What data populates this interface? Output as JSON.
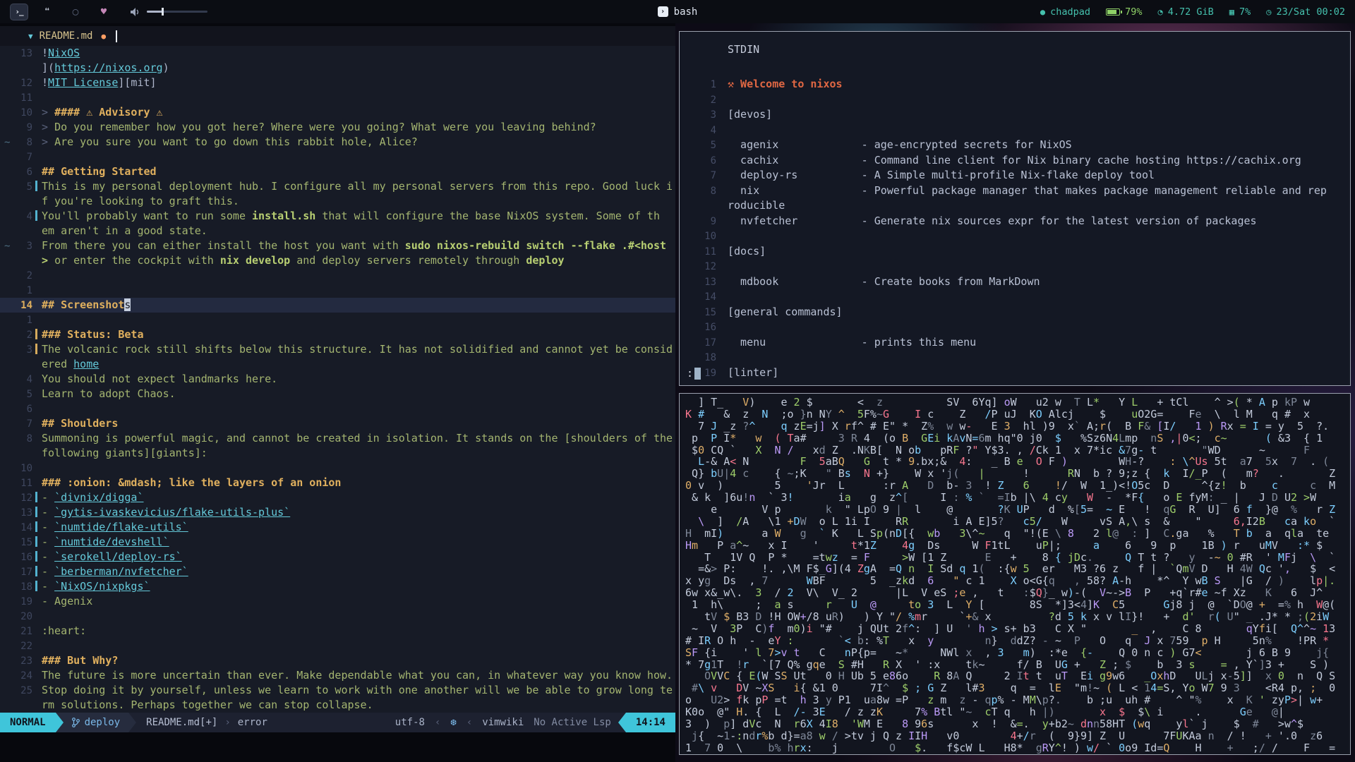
{
  "theme": {
    "bg_bar": "#0b0d13",
    "bg_editor": "#171b26",
    "bg_tabbar": "#12141d",
    "bg_status": "#1d2130",
    "bg_window": "#141824",
    "bg_noise": "#12151f",
    "accent": "#3fc5da",
    "teal": "#45c0ad",
    "green": "#8fd167",
    "yellow": "#e0b05e",
    "orange": "#ff9e64",
    "redorange": "#e06743",
    "md_text": "#a4b570",
    "code": "#b8cf72",
    "link": "#64c9d9"
  },
  "topbar": {
    "workspaces": [
      {
        "name": "terminal",
        "glyph": "›_",
        "active": true
      },
      {
        "name": "chat",
        "glyph": "❝",
        "active": false
      },
      {
        "name": "circle",
        "glyph": "◯",
        "active": false
      },
      {
        "name": "heart",
        "glyph": "♥",
        "active": false
      }
    ],
    "volume_percent": 25,
    "center": {
      "icon_glyph": "›",
      "label": "bash"
    },
    "status": {
      "host": "chadpad",
      "battery": "79%",
      "memory": "4.72 GiB",
      "cpu": "7%",
      "date": "23/Sat 00:02",
      "memory_icon": "◔",
      "cpu_icon": "▦",
      "date_icon": "◷",
      "host_icon": "●"
    }
  },
  "editor": {
    "tab": {
      "arrow": "▼",
      "filename": "README.md",
      "modified_dot": "●"
    },
    "rows": [
      {
        "n": "13",
        "t": [
          [
            "!",
            "w"
          ],
          [
            "NixOS",
            "l"
          ]
        ]
      },
      {
        "n": "",
        "t": [
          [
            "](",
            "w"
          ],
          [
            "https://nixos.org",
            "l"
          ],
          [
            ")",
            "w"
          ]
        ]
      },
      {
        "n": "12",
        "t": [
          [
            "!",
            "w"
          ],
          [
            "MIT License",
            "l"
          ],
          [
            "][mit]",
            "w"
          ]
        ]
      },
      {
        "n": "11",
        "t": []
      },
      {
        "n": "10",
        "t": [
          [
            "> ",
            "q"
          ],
          [
            "#### ⚠ Advisory ⚠",
            "h"
          ]
        ]
      },
      {
        "n": "9",
        "t": [
          [
            "> ",
            "q"
          ],
          [
            "Do you remember how you got here? Where were you going? What were you leaving behind?",
            "f"
          ]
        ]
      },
      {
        "n": "8",
        "p": "~",
        "t": [
          [
            "> ",
            "q"
          ],
          [
            "Are you sure you want to go down this rabbit hole, Alice?",
            "f"
          ]
        ]
      },
      {
        "n": "7",
        "t": []
      },
      {
        "n": "6",
        "t": [
          [
            "## Getting Started",
            "h"
          ]
        ]
      },
      {
        "n": "5",
        "s": "c",
        "t": [
          [
            "This is my personal deployment hub. I configure all my personal servers from this repo. Good luck i",
            "f"
          ]
        ]
      },
      {
        "n": "",
        "t": [
          [
            "f you're looking to graft this.",
            "f"
          ]
        ]
      },
      {
        "n": "4",
        "s": "c",
        "t": [
          [
            "You'll probably want to run some ",
            "f"
          ],
          [
            "install.sh",
            "c"
          ],
          [
            " that will configure the base NixOS system. Some of th",
            "f"
          ]
        ]
      },
      {
        "n": "",
        "t": [
          [
            "em aren't in a good state.",
            "f"
          ]
        ]
      },
      {
        "n": "3",
        "p": "~",
        "t": [
          [
            "From there you can either install the host you want with ",
            "f"
          ],
          [
            "sudo nixos-rebuild switch --flake .#<host",
            "c"
          ]
        ]
      },
      {
        "n": "",
        "t": [
          [
            "> ",
            "c"
          ],
          [
            "or enter the cockpit with ",
            "f"
          ],
          [
            "nix develop",
            "c"
          ],
          [
            " and deploy servers remotely through ",
            "f"
          ],
          [
            "deploy",
            "c"
          ]
        ]
      },
      {
        "n": "2",
        "t": []
      },
      {
        "n": "1",
        "t": []
      },
      {
        "n": "14",
        "cur": true,
        "t": [
          [
            "## Screenshot",
            "h"
          ],
          [
            "s",
            "k"
          ]
        ]
      },
      {
        "n": "1",
        "t": []
      },
      {
        "n": "2",
        "s": "y",
        "t": [
          [
            "### Status: Beta",
            "h"
          ]
        ]
      },
      {
        "n": "3",
        "s": "y",
        "t": [
          [
            "The volcanic rock still shifts below this structure. It has not solidified and cannot yet be consid",
            "f"
          ]
        ]
      },
      {
        "n": "",
        "t": [
          [
            "ered ",
            "f"
          ],
          [
            "home",
            "l"
          ]
        ]
      },
      {
        "n": "4",
        "t": [
          [
            "You should not expect landmarks here.",
            "f"
          ]
        ]
      },
      {
        "n": "5",
        "t": [
          [
            "Learn to adopt Chaos.",
            "f"
          ]
        ]
      },
      {
        "n": "6",
        "t": []
      },
      {
        "n": "7",
        "t": [
          [
            "## Shoulders",
            "h"
          ]
        ]
      },
      {
        "n": "8",
        "t": [
          [
            "Summoning is powerful magic, and cannot be created in isolation. It stands on the [shoulders of the",
            "f"
          ]
        ]
      },
      {
        "n": "",
        "t": [
          [
            "following giants][giants]:",
            "f"
          ]
        ]
      },
      {
        "n": "10",
        "t": []
      },
      {
        "n": "11",
        "t": [
          [
            "### :onion: &mdash; like the layers of an onion",
            "h"
          ]
        ]
      },
      {
        "n": "12",
        "s": "c",
        "t": [
          [
            "- ",
            "f"
          ],
          [
            "`divnix/digga`",
            "l"
          ]
        ]
      },
      {
        "n": "13",
        "s": "c",
        "t": [
          [
            "- ",
            "f"
          ],
          [
            "`gytis-ivaskevicius/flake-utils-plus`",
            "l"
          ]
        ]
      },
      {
        "n": "14",
        "s": "c",
        "t": [
          [
            "- ",
            "f"
          ],
          [
            "`numtide/flake-utils`",
            "l"
          ]
        ]
      },
      {
        "n": "15",
        "s": "c",
        "t": [
          [
            "- ",
            "f"
          ],
          [
            "`numtide/devshell`",
            "l"
          ]
        ]
      },
      {
        "n": "16",
        "s": "c",
        "t": [
          [
            "- ",
            "f"
          ],
          [
            "`serokell/deploy-rs`",
            "l"
          ]
        ]
      },
      {
        "n": "17",
        "s": "c",
        "t": [
          [
            "- ",
            "f"
          ],
          [
            "`berberman/nvfetcher`",
            "l"
          ]
        ]
      },
      {
        "n": "18",
        "s": "c",
        "t": [
          [
            "- ",
            "f"
          ],
          [
            "`NixOS/nixpkgs`",
            "l"
          ]
        ]
      },
      {
        "n": "19",
        "t": [
          [
            "- Agenix",
            "f"
          ]
        ]
      },
      {
        "n": "20",
        "t": []
      },
      {
        "n": "21",
        "t": [
          [
            ":heart:",
            "f"
          ]
        ]
      },
      {
        "n": "22",
        "t": []
      },
      {
        "n": "23",
        "t": [
          [
            "### But Why?",
            "h"
          ]
        ]
      },
      {
        "n": "24",
        "t": [
          [
            "The future is more uncertain than ever. Make dependable what you can, in whatever way you know how.",
            "f"
          ]
        ]
      },
      {
        "n": "25",
        "t": [
          [
            "Stop doing it by yourself, unless we learn to work with one another will we be able to grow long te",
            "f"
          ]
        ]
      },
      {
        "n": "",
        "t": [
          [
            "rm solutions. Perhaps together we can stop collapse.",
            "f"
          ]
        ]
      }
    ],
    "statusline": {
      "mode": "NORMAL",
      "git_branch": "deploy",
      "file": "README.md[+]",
      "chev": "›",
      "diagnostic": "error",
      "encoding": "utf-8",
      "sep": "‹",
      "os_icon": "❆",
      "filetype": "vimwiki",
      "lsp": "No Active Lsp",
      "time": "14:14"
    }
  },
  "pager": {
    "title": "STDIN",
    "prompt": ":",
    "rows": [
      {
        "n": "1",
        "t": [
          [
            "⚒ Welcome to nixos",
            "o"
          ]
        ]
      },
      {
        "n": "2",
        "t": []
      },
      {
        "n": "3",
        "t": [
          [
            "[devos]",
            "t"
          ]
        ]
      },
      {
        "n": "4",
        "t": []
      },
      {
        "n": "5",
        "t": [
          [
            "  agenix             - age-encrypted secrets for NixOS",
            "t"
          ]
        ]
      },
      {
        "n": "6",
        "t": [
          [
            "  cachix             - Command line client for Nix binary cache hosting https://cachix.org",
            "t"
          ]
        ]
      },
      {
        "n": "7",
        "t": [
          [
            "  deploy-rs          - A Simple multi-profile Nix-flake deploy tool",
            "t"
          ]
        ]
      },
      {
        "n": "8",
        "t": [
          [
            "  nix                - Powerful package manager that makes package management reliable and rep",
            "t"
          ]
        ]
      },
      {
        "n": "",
        "t": [
          [
            "roducible",
            "t"
          ]
        ]
      },
      {
        "n": "9",
        "t": [
          [
            "  nvfetcher          - Generate nix sources expr for the latest version of packages",
            "t"
          ]
        ]
      },
      {
        "n": "10",
        "t": []
      },
      {
        "n": "11",
        "t": [
          [
            "[docs]",
            "t"
          ]
        ]
      },
      {
        "n": "12",
        "t": []
      },
      {
        "n": "13",
        "t": [
          [
            "  mdbook             - Create books from MarkDown",
            "t"
          ]
        ]
      },
      {
        "n": "14",
        "t": []
      },
      {
        "n": "15",
        "t": [
          [
            "[general commands]",
            "t"
          ]
        ]
      },
      {
        "n": "16",
        "t": []
      },
      {
        "n": "17",
        "t": [
          [
            "  menu               - prints this menu",
            "t"
          ]
        ]
      },
      {
        "n": "18",
        "t": []
      },
      {
        "n": "19",
        "t": [
          [
            "[linter]",
            "t"
          ]
        ]
      }
    ]
  },
  "noise": {
    "rows": 30,
    "cols": 102,
    "seed": 1337,
    "space_prob": 0.52,
    "charset": "!\"#$%&'()*+,-./0123456789:;<=>?@ABCDEFGHIJKLMNOPQRSTUVWXYZ[\\]^_`abcdefghijklmnopqrstuvwxyz{|}~",
    "palette": [
      [
        "#c3cbdb",
        60
      ],
      [
        "#7e8798",
        12
      ],
      [
        "#9ece6a",
        8
      ],
      [
        "#7dcfff",
        8
      ],
      [
        "#e0af68",
        5
      ],
      [
        "#bb9af7",
        4
      ],
      [
        "#f7768e",
        3
      ]
    ]
  }
}
